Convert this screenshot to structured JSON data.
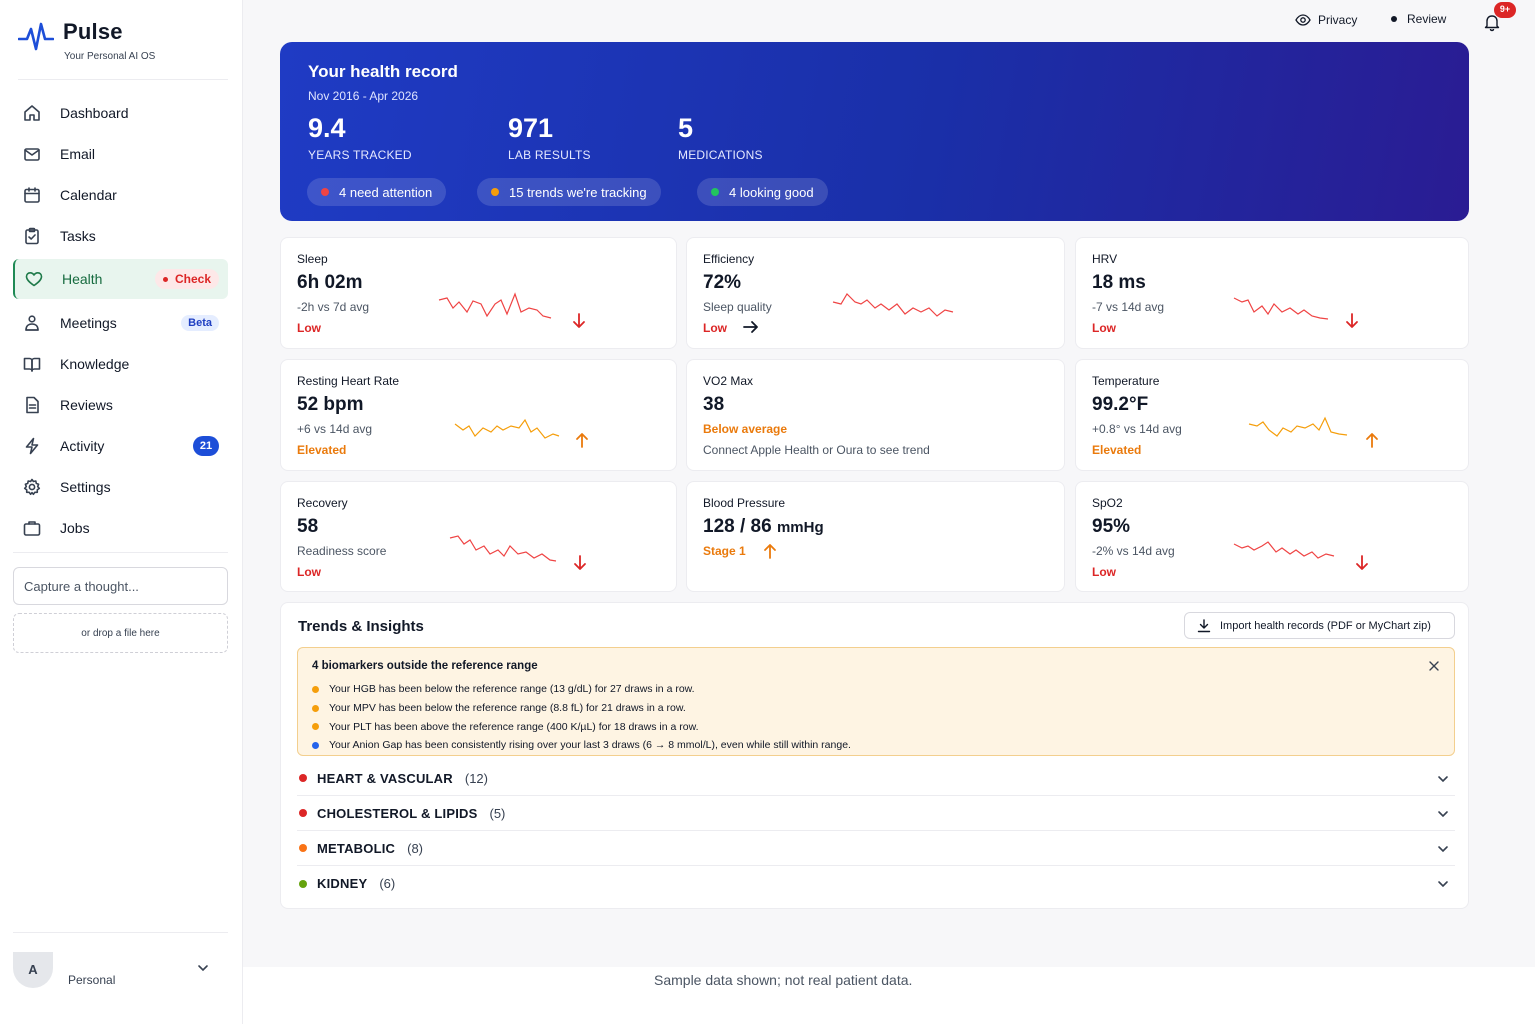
{
  "brand": {
    "name": "Pulse",
    "tagline": "Your Personal AI OS",
    "accent": "#1d4ed8"
  },
  "sidebar": {
    "items": [
      {
        "label": "Dashboard",
        "icon": "home-icon"
      },
      {
        "label": "Email",
        "icon": "mail-icon"
      },
      {
        "label": "Calendar",
        "icon": "calendar-icon"
      },
      {
        "label": "Tasks",
        "icon": "clipboard-icon"
      },
      {
        "label": "Health",
        "icon": "heart-icon",
        "active": true,
        "badge": "Check"
      },
      {
        "label": "Meetings",
        "icon": "people-icon",
        "badge": "Beta"
      },
      {
        "label": "Knowledge",
        "icon": "book-icon"
      },
      {
        "label": "Reviews",
        "icon": "document-icon"
      },
      {
        "label": "Activity",
        "icon": "bolt-icon",
        "badge": "21"
      },
      {
        "label": "Settings",
        "icon": "gear-icon"
      },
      {
        "label": "Jobs",
        "icon": "briefcase-icon"
      }
    ],
    "capture_placeholder": "Capture a thought...",
    "dropzone": "or drop a file here",
    "user": {
      "initial": "A",
      "label": "Personal"
    }
  },
  "topbar": {
    "privacy": "Privacy",
    "review": "Review",
    "notifications": "9+"
  },
  "hero": {
    "title": "Your health record",
    "range": "Nov 2016 - Apr 2026",
    "stats": [
      {
        "value": "9.4",
        "label": "YEARS TRACKED"
      },
      {
        "value": "971",
        "label": "LAB RESULTS"
      },
      {
        "value": "5",
        "label": "MEDICATIONS"
      }
    ],
    "pills": [
      {
        "label": "4 need attention",
        "color": "#ef4444"
      },
      {
        "label": "15 trends we're tracking",
        "color": "#f59e0b"
      },
      {
        "label": "4 looking good",
        "color": "#22c55e"
      }
    ]
  },
  "metrics": [
    {
      "title": "Sleep",
      "value": "6h 02m",
      "sub": "-2h vs 7d avg",
      "status": "Low",
      "trend": "down"
    },
    {
      "title": "Efficiency",
      "value": "72%",
      "sub": "Sleep quality",
      "status": "Low",
      "trend": "right"
    },
    {
      "title": "HRV",
      "value": "18 ms",
      "sub": "-7 vs 14d avg",
      "status": "Low",
      "trend": "down"
    },
    {
      "title": "Resting Heart Rate",
      "value": "52 bpm",
      "sub": "+6 vs 14d avg",
      "status": "Elevated",
      "trend": "up"
    },
    {
      "title": "VO2 Max",
      "value": "38",
      "sub": "Below average",
      "note": "Connect Apple Health or Oura to see trend"
    },
    {
      "title": "Temperature",
      "value": "99.2°F",
      "sub": "+0.8° vs 14d avg",
      "status": "Elevated",
      "trend": "up"
    },
    {
      "title": "Recovery",
      "value": "58",
      "sub": "Readiness score",
      "status": "Low",
      "trend": "down"
    },
    {
      "title": "Blood Pressure",
      "value": "128 / 86",
      "unit": "mmHg",
      "status": "Stage 1",
      "trend": "up"
    },
    {
      "title": "SpO2",
      "value": "95%",
      "sub": "-2% vs 14d avg",
      "status": "Low",
      "trend": "down"
    }
  ],
  "trends": {
    "title": "Trends & Insights",
    "import_label": "Import health records (PDF or MyChart zip)",
    "alert": {
      "title": "4 biomarkers outside the reference range",
      "items": [
        {
          "text": "Your HGB has been below the reference range (13 g/dL) for 27 draws in a row.",
          "color": "#f59e0b"
        },
        {
          "text": "Your MPV has been below the reference range (8.8 fL) for 21 draws in a row.",
          "color": "#f59e0b"
        },
        {
          "text": "Your PLT has been above the reference range (400 K/µL) for 18 draws in a row.",
          "color": "#f59e0b"
        },
        {
          "text": "Your Anion Gap has been consistently rising over your last 3 draws (6 → 8 mmol/L), even while still within range.",
          "color": "#2563eb"
        }
      ]
    },
    "categories": [
      {
        "name": "HEART & VASCULAR",
        "count": "(12)",
        "color": "#dc2626"
      },
      {
        "name": "CHOLESTEROL & LIPIDS",
        "count": "(5)",
        "color": "#dc2626"
      },
      {
        "name": "METABOLIC",
        "count": "(8)",
        "color": "#f97316"
      },
      {
        "name": "KIDNEY",
        "count": "(6)",
        "color": "#65a30d"
      }
    ]
  },
  "footer": "Sample data shown; not real patient data."
}
